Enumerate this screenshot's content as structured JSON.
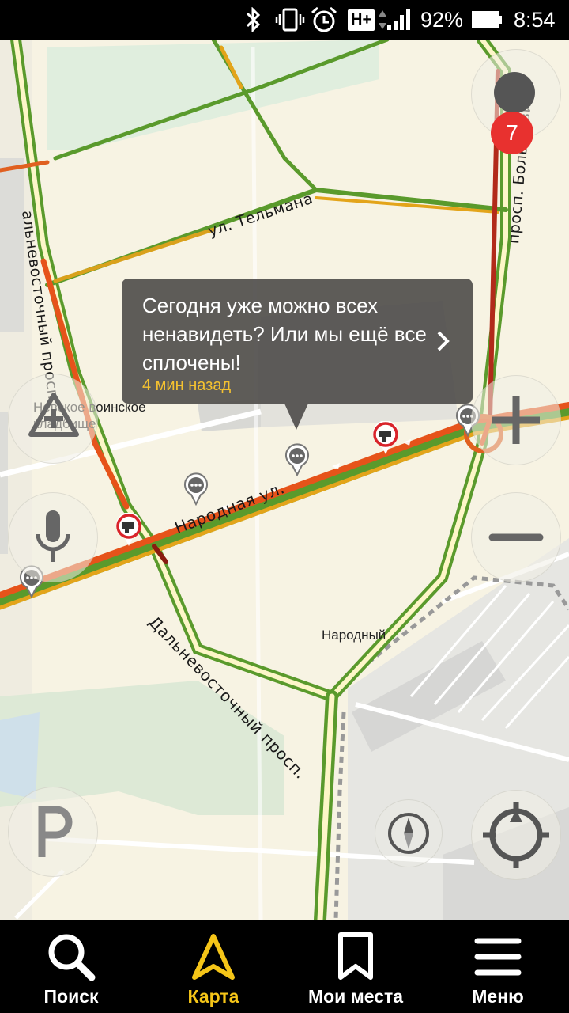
{
  "status_bar": {
    "battery_percent": "92%",
    "time": "8:54",
    "network_label": "H+"
  },
  "map": {
    "roads": {
      "dalnevostochny_top": "альневосточный просп.",
      "telmana": "ул. Тельмана",
      "bolshevikov": "просп. Большевик",
      "narodnaya": "Народная ул.",
      "dalnevostochny_bottom": "Дальневосточный просп."
    },
    "places": {
      "cemetery": "Невское воинское кладбище",
      "narodny": "Народный"
    },
    "traffic_score": "7"
  },
  "popup": {
    "message": "Сегодня уже можно всех ненавидеть? Или мы ещё все сплочены!",
    "time_ago": "4 мин назад"
  },
  "controls": {
    "icons": [
      "road-alert-icon",
      "microphone-icon",
      "parking-icon",
      "zoom-in-icon",
      "zoom-out-icon",
      "compass-icon",
      "locate-me-icon"
    ]
  },
  "bottom_nav": {
    "items": [
      {
        "label": "Поиск",
        "icon": "search-icon"
      },
      {
        "label": "Карта",
        "icon": "map-arrow-icon"
      },
      {
        "label": "Мои места",
        "icon": "bookmark-icon"
      },
      {
        "label": "Меню",
        "icon": "menu-icon"
      }
    ],
    "active_index": 1,
    "active_color": "#f5c518"
  }
}
